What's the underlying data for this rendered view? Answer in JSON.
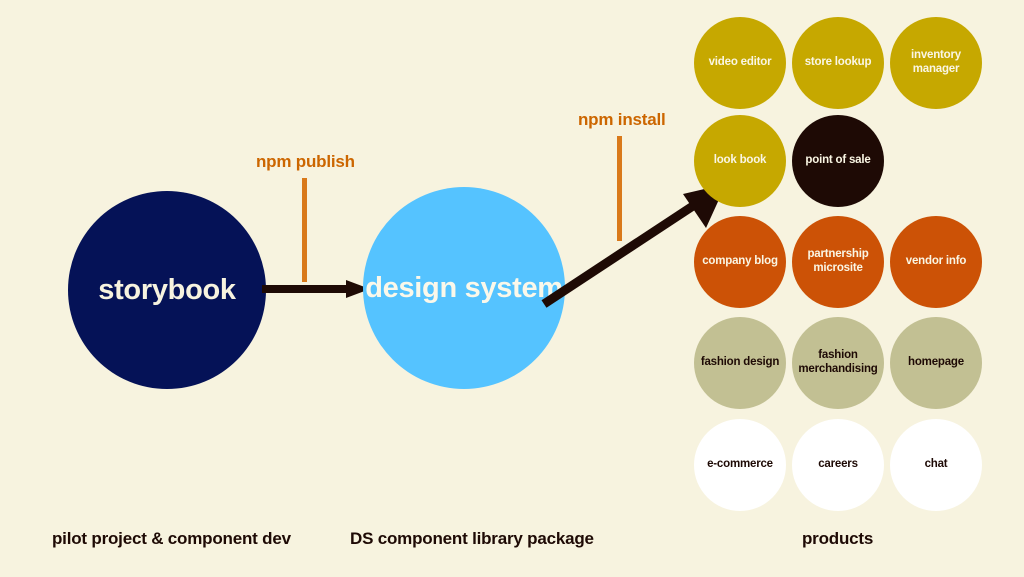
{
  "background_color": "#f7f3df",
  "nodes": [
    {
      "id": "storybook",
      "label": "storybook",
      "color": "#051257",
      "text_color": "#f7f3df"
    },
    {
      "id": "design-system",
      "label": "design system",
      "color": "#55c3ff",
      "text_color": "#fbf8ea"
    }
  ],
  "annotations": [
    {
      "id": "npm-publish",
      "label": "npm publish",
      "color": "#cc6600"
    },
    {
      "id": "npm-install",
      "label": "npm install",
      "color": "#cc6600"
    }
  ],
  "arrows": [
    {
      "id": "storybook-to-design-system",
      "style": "straight",
      "color": "#1e0a05"
    },
    {
      "id": "design-system-to-products",
      "style": "diagonal",
      "color": "#1e0a05"
    }
  ],
  "captions": {
    "pilot": "pilot project & component dev",
    "package": "DS component library package",
    "products": "products"
  },
  "products": {
    "rows": [
      [
        {
          "label": "video editor",
          "color": "#c6a800",
          "text_color": "#faf6e4"
        },
        {
          "label": "store lookup",
          "color": "#c6a800",
          "text_color": "#faf6e4"
        },
        {
          "label": "inventory manager",
          "color": "#c6a800",
          "text_color": "#faf6e4"
        }
      ],
      [
        {
          "label": "look book",
          "color": "#c6a800",
          "text_color": "#faf6e4"
        },
        {
          "label": "point of sale",
          "color": "#1e0a05",
          "text_color": "#faf6e4"
        }
      ],
      [
        {
          "label": "company blog",
          "color": "#cc5206",
          "text_color": "#faf6e4"
        },
        {
          "label": "partnership microsite",
          "color": "#cc5206",
          "text_color": "#faf6e4"
        },
        {
          "label": "vendor info",
          "color": "#cc5206",
          "text_color": "#faf6e4"
        }
      ],
      [
        {
          "label": "fashion design",
          "color": "#c2c093",
          "text_color": "#1e0a05"
        },
        {
          "label": "fashion merchandising",
          "color": "#c2c093",
          "text_color": "#1e0a05"
        },
        {
          "label": "homepage",
          "color": "#c2c093",
          "text_color": "#1e0a05"
        }
      ],
      [
        {
          "label": "e-commerce",
          "color": "#ffffff",
          "text_color": "#1e0a05"
        },
        {
          "label": "careers",
          "color": "#ffffff",
          "text_color": "#1e0a05"
        },
        {
          "label": "chat",
          "color": "#ffffff",
          "text_color": "#1e0a05"
        }
      ]
    ]
  }
}
